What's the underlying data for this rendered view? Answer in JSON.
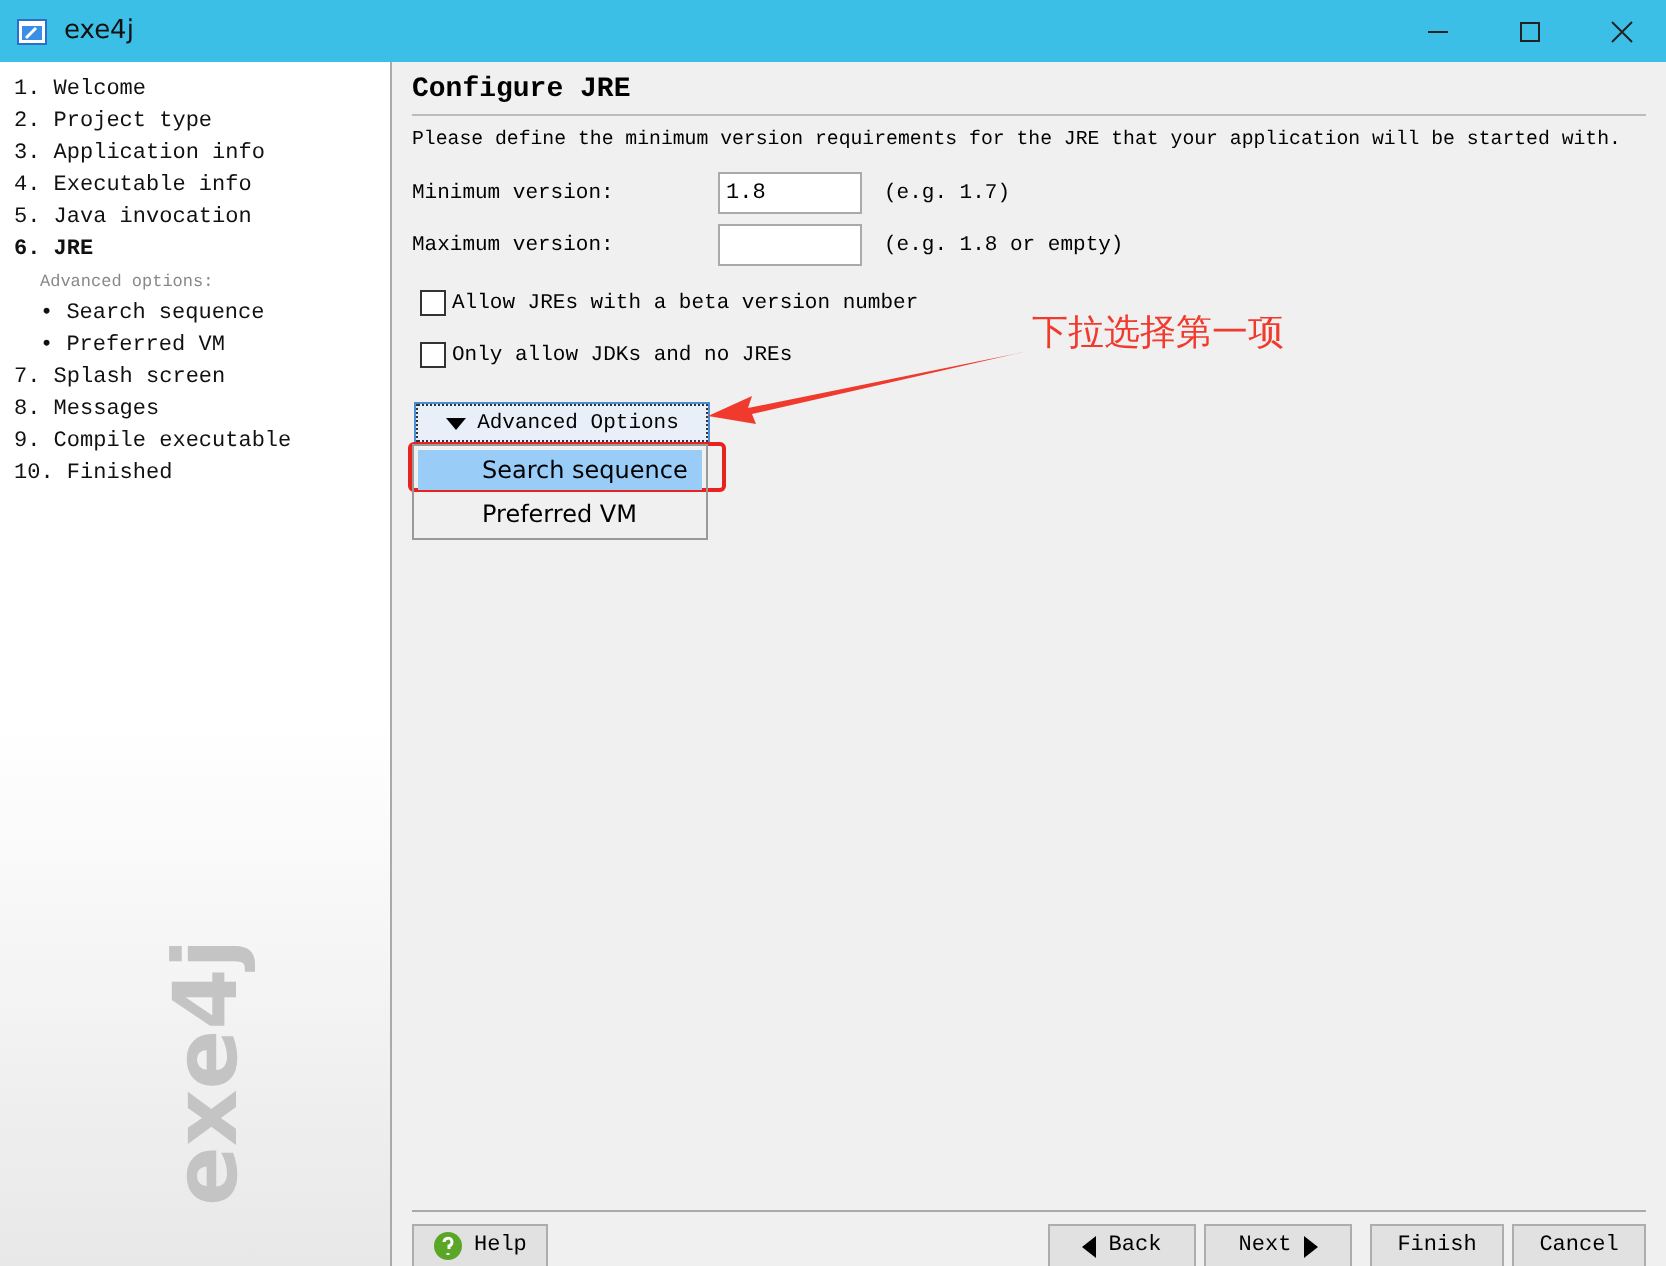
{
  "window": {
    "title": "exe4j"
  },
  "steps": [
    {
      "label": "1. Welcome",
      "selected": false
    },
    {
      "label": "2. Project type",
      "selected": false
    },
    {
      "label": "3. Application info",
      "selected": false
    },
    {
      "label": "4. Executable info",
      "selected": false
    },
    {
      "label": "5. Java invocation",
      "selected": false
    },
    {
      "label": "6. JRE",
      "selected": true,
      "children_heading": "Advanced options:",
      "children": [
        {
          "label": "• Search sequence",
          "selected": false
        },
        {
          "label": "• Preferred VM",
          "selected": false
        }
      ]
    },
    {
      "label": "7. Splash screen",
      "selected": false
    },
    {
      "label": "8. Messages",
      "selected": false
    },
    {
      "label": "9. Compile executable",
      "selected": false
    },
    {
      "label": "10. Finished",
      "selected": false
    }
  ],
  "sidebar_logo": "exe4j",
  "page": {
    "title": "Configure JRE",
    "description": "Please define the minimum version requirements for the JRE that your application will be started with.",
    "fields": [
      {
        "label": "Minimum version:",
        "value": "1.8",
        "hint": "(e.g. 1.7)"
      },
      {
        "label": "Maximum version:",
        "hint": "(e.g. 1.8 or empty)"
      }
    ],
    "checkboxes": [
      {
        "label": "Allow JREs with a beta version number",
        "checked": false
      },
      {
        "label": "Only allow JDKs and no JREs",
        "checked": false
      }
    ],
    "advanced_button": {
      "label": "Advanced Options",
      "expanded": true
    },
    "menu_items": [
      {
        "label": "Search sequence",
        "selected": true
      },
      {
        "label": "Preferred VM",
        "selected": false
      }
    ]
  },
  "annotation": {
    "text": "下拉选择第一项"
  },
  "buttons": [
    {
      "label": "Help",
      "kind": "help"
    },
    {
      "label": "Back",
      "kind": "back"
    },
    {
      "label": "Next",
      "kind": "next"
    },
    {
      "label": "Finish",
      "kind": "plain"
    },
    {
      "label": "Cancel",
      "kind": "plain"
    }
  ]
}
